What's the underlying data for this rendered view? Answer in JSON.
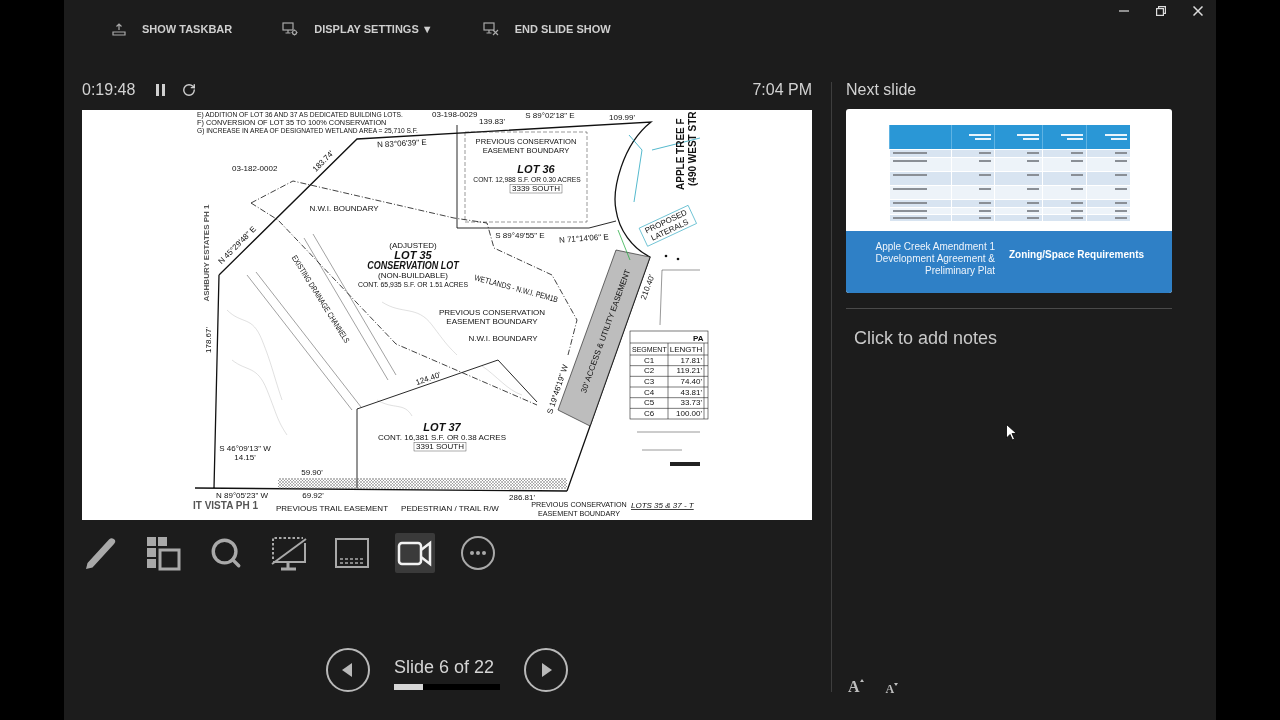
{
  "toolbar": [
    {
      "label": "SHOW TASKBAR"
    },
    {
      "label": "DISPLAY SETTINGS ▼"
    },
    {
      "label": "END SLIDE SHOW"
    }
  ],
  "timer": {
    "elapsed": "0:19:48",
    "running": true
  },
  "clock": "7:04 PM",
  "current_slide": {
    "plan_labels": [
      {
        "lines": [
          "(490 WEST STR"
        ]
      },
      {
        "lines": [
          "E) ADDITION OF LOT 36 AND 37 AS DEDICATED BUILDING LOTS."
        ]
      },
      {
        "lines": [
          "03-198-0029"
        ]
      },
      {
        "lines": [
          "S 89°02'18\" E"
        ]
      },
      {
        "lines": [
          "109.99'"
        ]
      },
      {
        "lines": [
          "APPLE TREE F"
        ]
      },
      {
        "lines": [
          "139.83'"
        ]
      },
      {
        "lines": [
          "F) CONVERSION OF LOT 35 TO 100% CONSERVATION"
        ]
      },
      {
        "lines": [
          "G) INCREASE IN AREA OF DESIGNATED WETLAND AREA = 25,710 S.F."
        ]
      },
      {
        "lines": [
          "PREVIOUS CONSERVATION",
          "EASEMENT BOUNDARY"
        ]
      },
      {
        "lines": [
          "N 83°06'39\" E"
        ]
      },
      {
        "lines": [
          "183.74'"
        ]
      },
      {
        "lines": [
          "LOT 36"
        ]
      },
      {
        "lines": [
          "03-182-0002"
        ]
      },
      {
        "lines": [
          "CONT. 12,988 S.F. OR 0.30 ACRES"
        ]
      },
      {
        "lines": [
          "3339 SOUTH"
        ]
      },
      {
        "lines": [
          "ASHBURY ESTATES PH 1"
        ]
      },
      {
        "lines": [
          "N.W.I. BOUNDARY"
        ]
      },
      {
        "lines": [
          "PROPOSED",
          "LATERALS"
        ]
      },
      {
        "lines": [
          "N 45°29'48\" E"
        ]
      },
      {
        "lines": [
          "S 89°49'55\" E"
        ]
      },
      {
        "lines": [
          "N 71°14'06\" E"
        ]
      },
      {
        "lines": [
          "(ADJUSTED)"
        ]
      },
      {
        "lines": [
          "LOT 35"
        ]
      },
      {
        "lines": [
          "EXISTING DRAINAGE CHANNELS"
        ]
      },
      {
        "lines": [
          "CONSERVATION LOT"
        ]
      },
      {
        "lines": [
          "30' ACCESS & UTILITY EASEMENT"
        ]
      },
      {
        "lines": [
          "(NON-BUILDABLE)"
        ]
      },
      {
        "lines": [
          "WETLANDS - N.W.I. PEM1B"
        ]
      },
      {
        "lines": [
          "210.40'"
        ]
      },
      {
        "lines": [
          "CONT. 65,935 S.F. OR 1.51 ACRES"
        ]
      },
      {
        "lines": [
          "PREVIOUS CONSERVATION",
          "EASEMENT BOUNDARY"
        ]
      },
      {
        "lines": [
          "178.67'"
        ]
      },
      {
        "lines": [
          "N.W.I. BOUNDARY"
        ]
      },
      {
        "lines": [
          "S 19°46'19\" W"
        ]
      },
      {
        "lines": [
          "124.40'"
        ]
      },
      {
        "lines": [
          "LOT 37"
        ]
      },
      {
        "lines": [
          "CONT. 16,381 S.F. OR 0.38 ACRES"
        ]
      },
      {
        "lines": [
          "3391 SOUTH"
        ]
      },
      {
        "lines": [
          "S 46°09'13\" W",
          "14.15'"
        ]
      },
      {
        "lines": [
          "59.90'"
        ]
      },
      {
        "lines": [
          "N 89°05'23\" W"
        ]
      },
      {
        "lines": [
          "69.92'"
        ]
      },
      {
        "lines": [
          "286.81'"
        ]
      },
      {
        "lines": [
          "IT VISTA PH 1"
        ]
      },
      {
        "lines": [
          "PREVIOUS TRAIL EASEMENT"
        ]
      },
      {
        "lines": [
          "PEDESTRIAN / TRAIL R/W"
        ]
      },
      {
        "lines": [
          "PREVIOUS CONSERVATION",
          "EASEMENT BOUNDARY"
        ]
      },
      {
        "lines": [
          "LOTS 35 & 37 - T"
        ]
      }
    ],
    "segment_table": {
      "title": "PA",
      "columns": [
        "SEGMENT",
        "LENGTH"
      ],
      "rows": [
        {
          "segment": "C1",
          "length": "17.81'"
        },
        {
          "segment": "C2",
          "length": "119.21'"
        },
        {
          "segment": "C3",
          "length": "74.40'"
        },
        {
          "segment": "C4",
          "length": "43.81'"
        },
        {
          "segment": "C5",
          "length": "33.73'"
        },
        {
          "segment": "C6",
          "length": "100.00'"
        }
      ]
    }
  },
  "tools": [
    {
      "selected": false
    },
    {
      "selected": false
    },
    {
      "selected": false
    },
    {
      "selected": false
    },
    {
      "selected": false
    },
    {
      "selected": true
    },
    {
      "selected": false
    }
  ],
  "navigation": {
    "label": "Slide 6 of 22",
    "level": 0.27
  },
  "next_slide": {
    "heading": "Next slide",
    "title_lines": [
      "Apple Creek Amendment 1",
      "Development Agreement &",
      "Preliminary Plat"
    ],
    "subtitle": "Zoning/Space Requirements"
  },
  "notes": {
    "placeholder": "Click to add notes"
  },
  "font_size_buttons": [
    {
      "label": "A"
    },
    {
      "label": "A"
    }
  ]
}
